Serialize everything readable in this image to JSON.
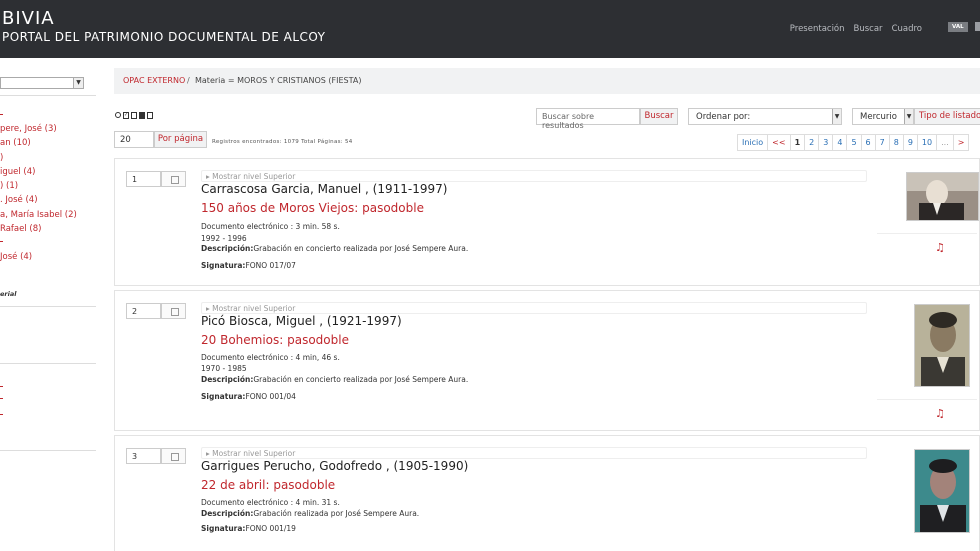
{
  "header": {
    "title": "BIVIA",
    "subtitle": "PORTAL DEL PATRIMONIO DOCUMENTAL DE ALCOY",
    "nav": [
      "Presentación",
      "Buscar",
      "Cuadro"
    ],
    "lang": "VAL"
  },
  "sidebar": {
    "facet_items": [
      "pere, José (3)",
      "an (10)",
      ")",
      "iguel (4)",
      ") (1)",
      ". José (4)",
      "a, María Isabel (2)",
      "Rafael (8)",
      "José (4)"
    ],
    "heading": "erial"
  },
  "breadcrumb": {
    "root": "OPAC EXTERNO",
    "separator": "/",
    "current": "Materia = MOROS Y CRISTIANOS (FIESTA)"
  },
  "toolbar": {
    "search_placeholder": "Buscar sobre resultados",
    "search_button": "Buscar",
    "order_label": "Ordenar por:",
    "style_value": "Mercurio",
    "list_type_button": "Tipo de listado",
    "per_page_value": "20",
    "per_page_button": "Por página",
    "records_info": "Registros encontrados: 1079 Total Páginas: 54"
  },
  "pagination": {
    "first": "Inicio",
    "prev": "<<",
    "pages": [
      "1",
      "2",
      "3",
      "4",
      "5",
      "6",
      "7",
      "8",
      "9",
      "10"
    ],
    "ellipsis": "...",
    "next": ">"
  },
  "results": [
    {
      "number": "1",
      "parent_link": "Mostrar nivel Superior",
      "author": "Carrascosa Garcia, Manuel , (1911-1997)",
      "title": "150 años de Moros Viejos: pasodoble",
      "format": "Documento electrónico : 3 min. 58 s.",
      "dates": "1992 - 1996",
      "description_label": "Descripción:",
      "description": "Grabación en concierto realizada por José Sempere Aura.",
      "signature_label": "Signatura:",
      "signature": "FONO 017/07"
    },
    {
      "number": "2",
      "parent_link": "Mostrar nivel Superior",
      "author": "Picó Biosca, Miguel , (1921-1997)",
      "title": "20 Bohemios: pasodoble",
      "format": "Documento electrónico : 4 min, 46 s.",
      "dates": "1970 - 1985",
      "description_label": "Descripción:",
      "description": "Grabación en concierto realizada por José Sempere Aura.",
      "signature_label": "Signatura:",
      "signature": "FONO 001/04"
    },
    {
      "number": "3",
      "parent_link": "Mostrar nivel Superior",
      "author": "Garrigues Perucho, Godofredo , (1905-1990)",
      "title": "22 de abril: pasodoble",
      "format": "Documento electrónico : 4 min. 31 s.",
      "description_label": "Descripción:",
      "description": "Grabación realizada por José Sempere Aura.",
      "signature_label": "Signatura:",
      "signature": "FONO 001/19"
    }
  ],
  "colors": {
    "header_bg": "#2d2f33",
    "accent_red": "#c0272d",
    "link_blue": "#2a6fb5"
  }
}
